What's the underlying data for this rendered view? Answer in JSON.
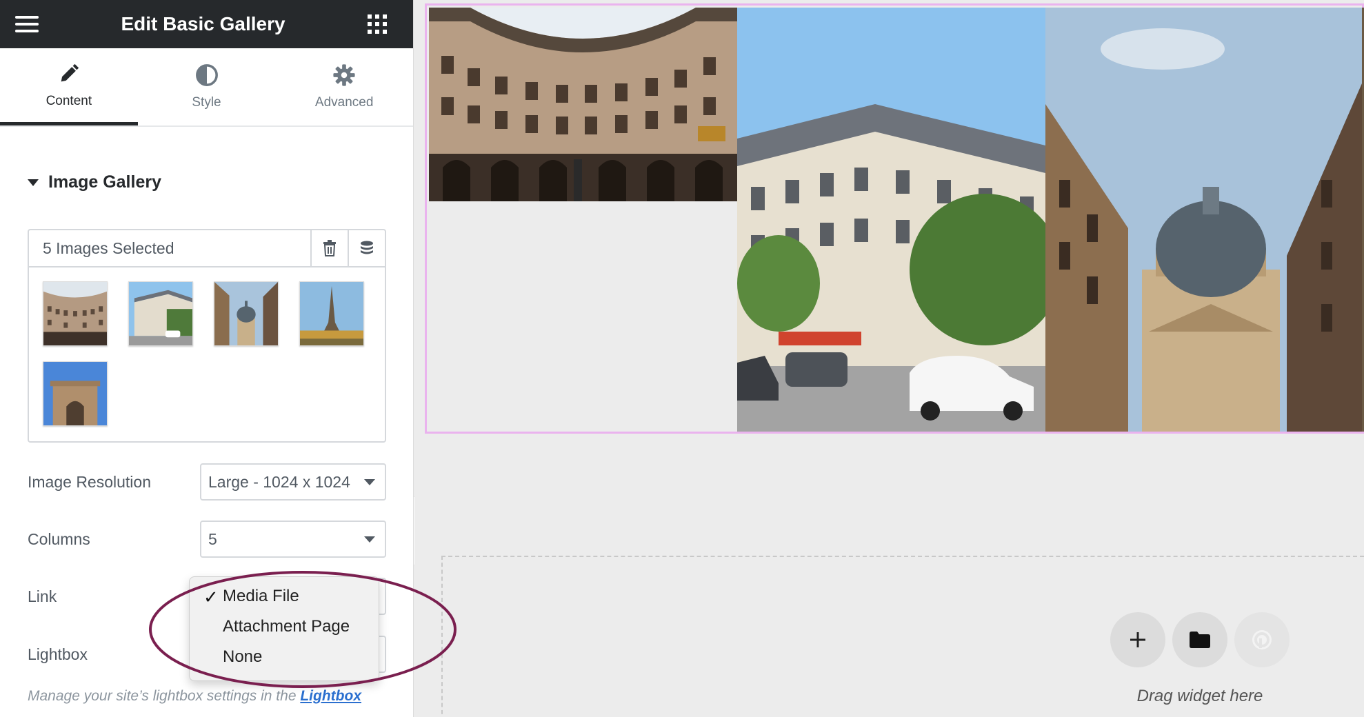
{
  "panel": {
    "title": "Edit Basic Gallery",
    "tabs": [
      {
        "label": "Content",
        "active": true
      },
      {
        "label": "Style",
        "active": false
      },
      {
        "label": "Advanced",
        "active": false
      }
    ],
    "section_title": "Image Gallery",
    "gallery": {
      "count_label": "5 Images Selected",
      "thumbnails": [
        "courtyard-building",
        "paris-street-corner",
        "pantheon-street",
        "eiffel-tower",
        "arc-de-triomphe"
      ]
    },
    "controls": {
      "resolution": {
        "label": "Image Resolution",
        "value": "Large - 1024 x 1024"
      },
      "columns": {
        "label": "Columns",
        "value": "5"
      },
      "link": {
        "label": "Link"
      },
      "lightbox": {
        "label": "Lightbox"
      }
    },
    "link_options": {
      "selected_mark": "✓",
      "items": [
        "Media File",
        "Attachment Page",
        "None"
      ],
      "selected_index": 0
    },
    "note": {
      "text": "Manage your site’s lightbox settings in the",
      "link": "Lightbox"
    }
  },
  "canvas": {
    "drop_zone_text": "Drag widget here",
    "buttons": [
      "add-icon",
      "folder-icon",
      "plugin-icon"
    ]
  },
  "colors": {
    "topbar": "#26292c",
    "widget_outline": "#eab3ee",
    "annotation": "#7a1f4f",
    "link": "#2a6fcf"
  }
}
